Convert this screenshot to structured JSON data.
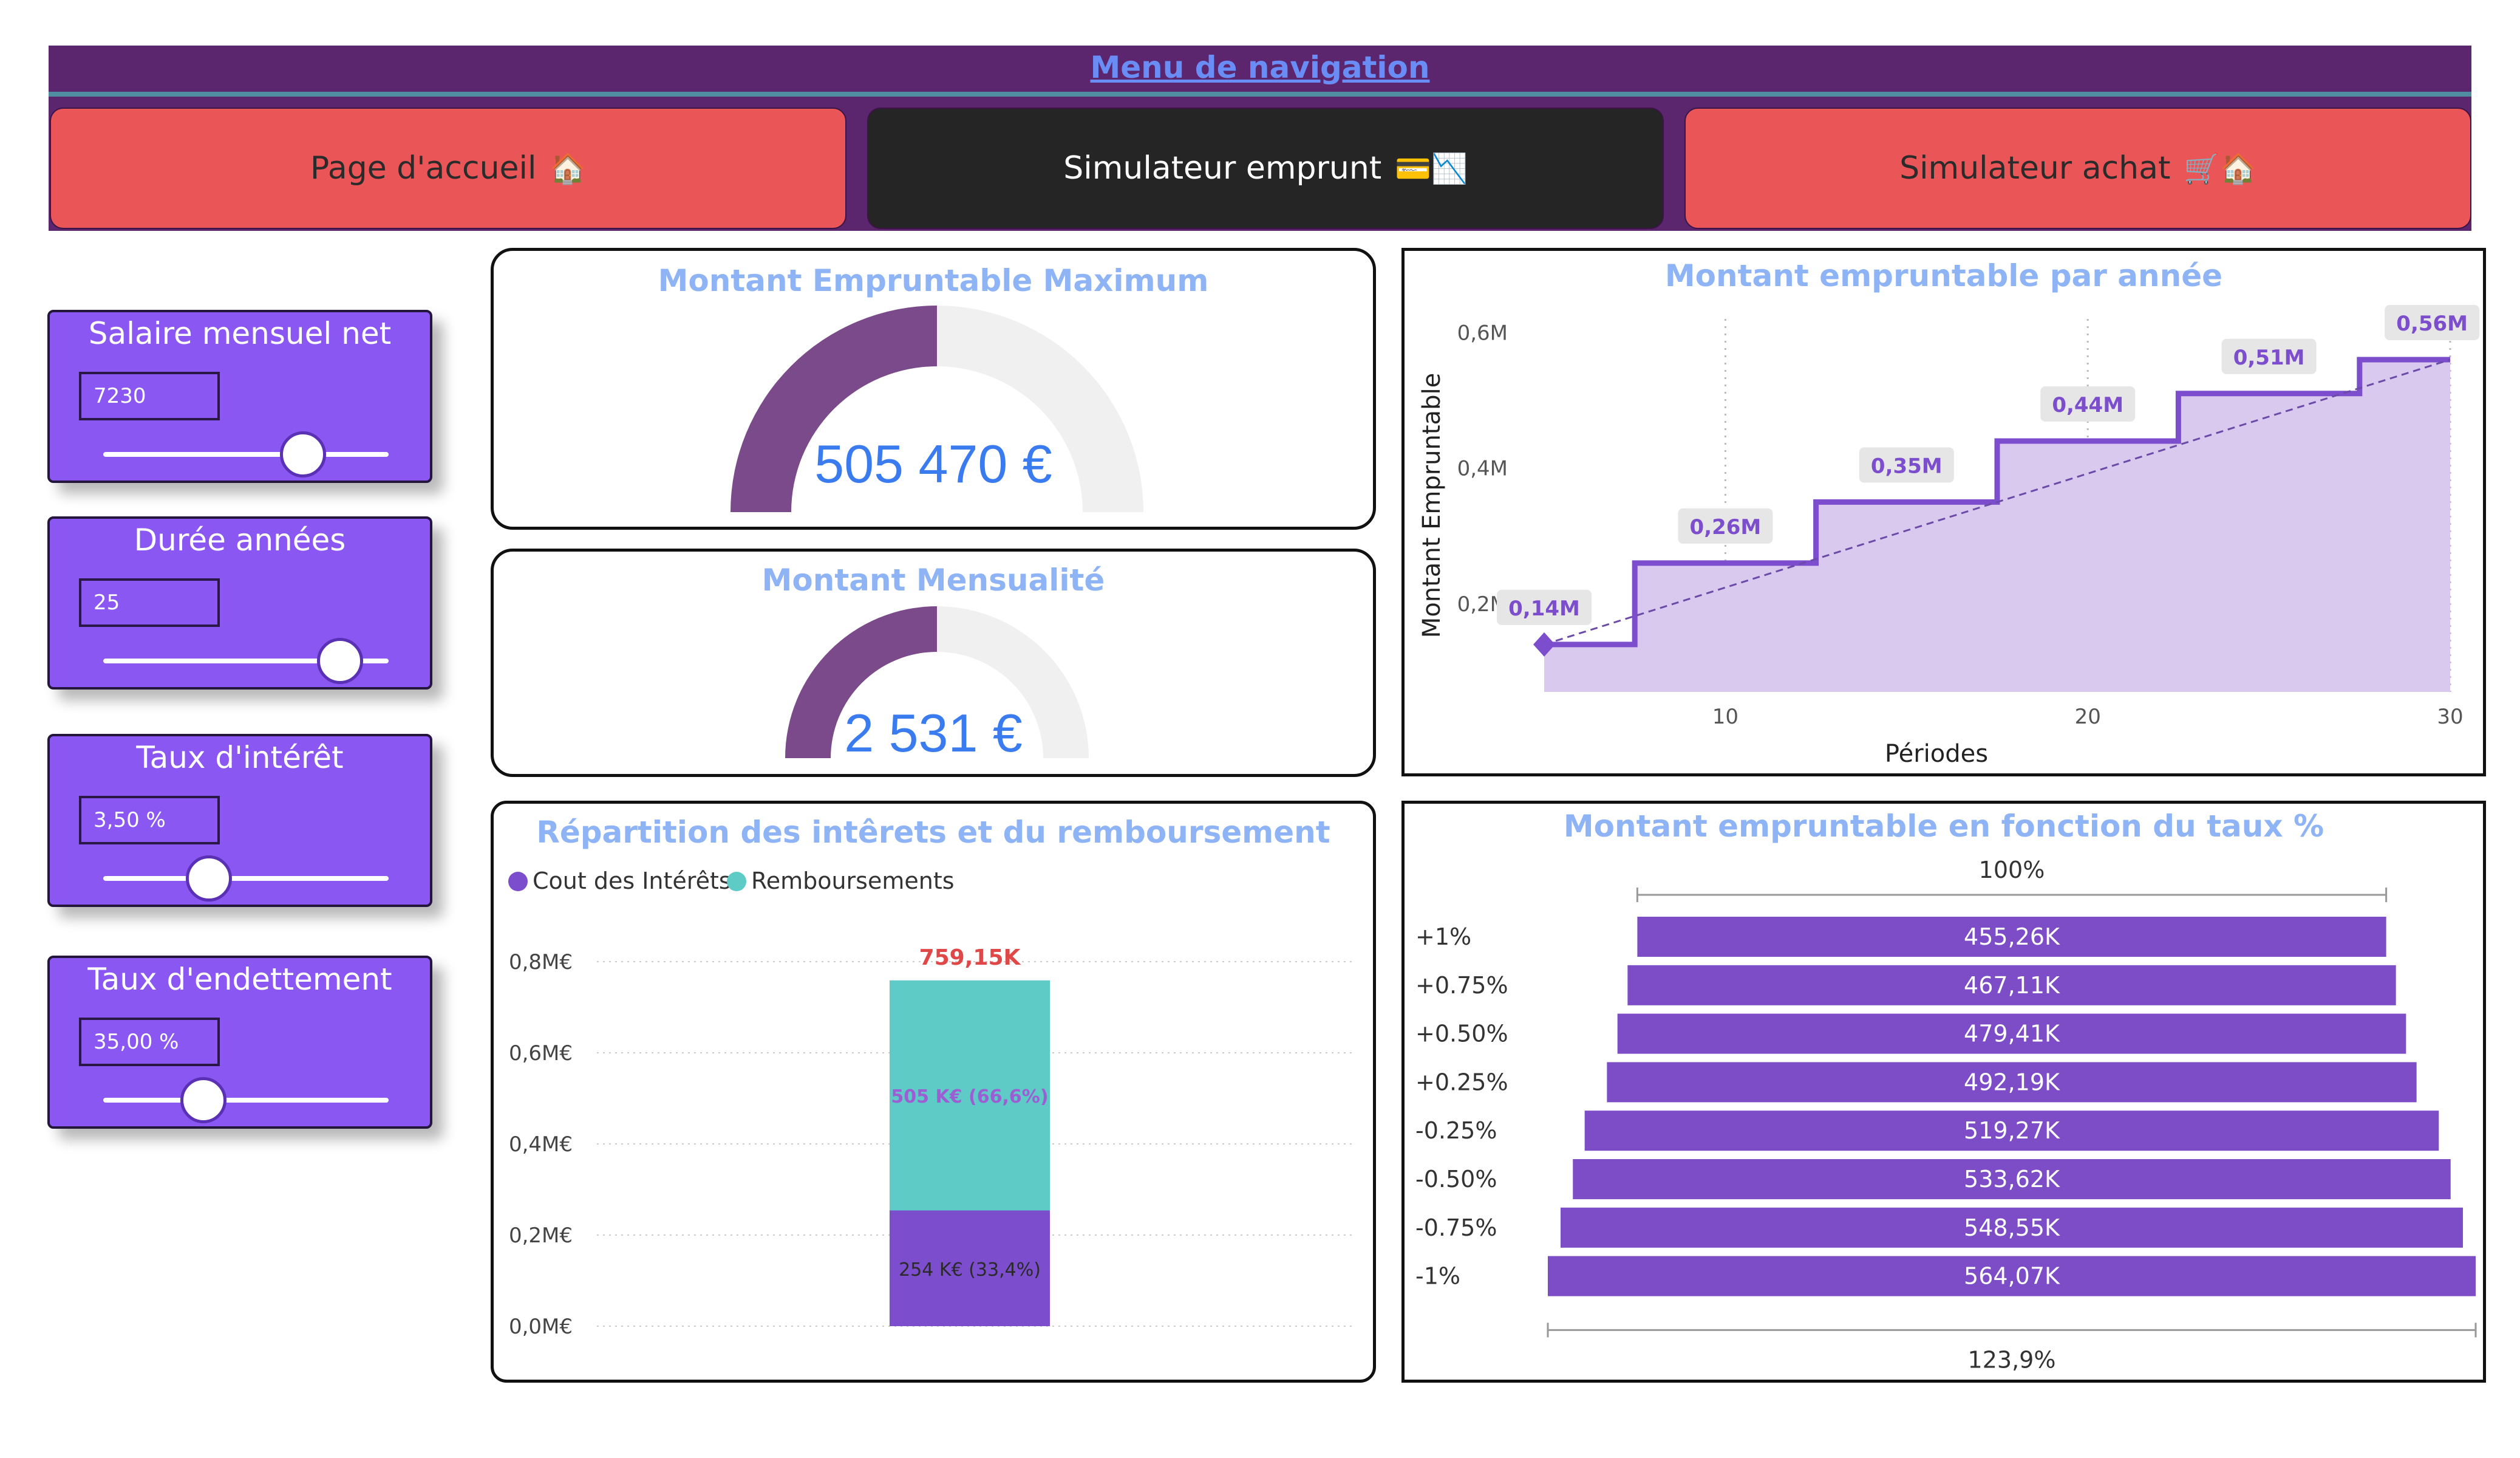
{
  "nav": {
    "title": "Menu de navigation",
    "buttons": [
      {
        "label": "Page d'accueil",
        "icons": "🏠"
      },
      {
        "label": "Simulateur emprunt",
        "icons": "💳📉"
      },
      {
        "label": "Simulateur achat",
        "icons": "🛒🏠"
      }
    ]
  },
  "slicers": [
    {
      "title": "Salaire mensuel net",
      "value": "7230",
      "level": 0.7
    },
    {
      "title": "Durée années",
      "value": "25",
      "level": 0.83
    },
    {
      "title": "Taux d'intérêt",
      "value": "3,50 %",
      "level": 0.37
    },
    {
      "title": "Taux d'endettement",
      "value": "35,00 %",
      "level": 0.35
    }
  ],
  "gauges": [
    {
      "title": "Montant Empruntable Maximum",
      "value_text": "505 470 €",
      "fraction": 0.5
    },
    {
      "title": "Montant Mensualité",
      "value_text": "2 531 €",
      "fraction": 0.5
    }
  ],
  "colors": {
    "accent_purple": "#7c4dcc",
    "gauge_fill": "#7b4a8a",
    "gauge_bg": "#f0f0f0",
    "teal": "#5ecbc6",
    "nav_purple": "#5b266e",
    "nav_red": "#ea5557",
    "slicer": "#8b57f3"
  },
  "chart_data": [
    {
      "type": "line",
      "title": "Montant empruntable par année",
      "xlabel": "Périodes",
      "ylabel": "Montant Empruntable",
      "x_ticks": [
        "10",
        "20",
        "30"
      ],
      "y_ticks": [
        "0,2M",
        "0,4M",
        "0,6M"
      ],
      "xlim": [
        5,
        30
      ],
      "ylim": [
        0.07,
        0.62
      ],
      "step_x": [
        5,
        7.5,
        12.5,
        17.5,
        22.5,
        27.5,
        30
      ],
      "step_y": [
        0.14,
        0.26,
        0.35,
        0.44,
        0.51,
        0.56,
        0.56
      ],
      "labels": [
        {
          "x": 5,
          "y": 0.14,
          "text": "0,14M"
        },
        {
          "x": 10,
          "y": 0.26,
          "text": "0,26M"
        },
        {
          "x": 15,
          "y": 0.35,
          "text": "0,35M"
        },
        {
          "x": 20,
          "y": 0.44,
          "text": "0,44M"
        },
        {
          "x": 25,
          "y": 0.51,
          "text": "0,51M"
        },
        {
          "x": 29.5,
          "y": 0.56,
          "text": "0,56M"
        }
      ],
      "trend": [
        [
          5,
          0.14
        ],
        [
          30,
          0.56
        ]
      ]
    },
    {
      "type": "bar",
      "title": "Répartition des intêrets et du remboursement",
      "legend": [
        "Cout des Intérêts",
        "Remboursements"
      ],
      "y_ticks": [
        "0,0M€",
        "0,2M€",
        "0,4M€",
        "0,6M€",
        "0,8M€"
      ],
      "ylim": [
        0,
        0.8
      ],
      "series": [
        {
          "name": "Cout des Intérêts",
          "values": [
            0.254
          ],
          "label": "254 K€ (33,4%)"
        },
        {
          "name": "Remboursements",
          "values": [
            0.505
          ],
          "label": "505 K€ (66,6%)"
        }
      ],
      "total_label": "759,15K"
    },
    {
      "type": "bar",
      "title": "Montant empruntable en fonction du taux %",
      "categories": [
        "+1%",
        "+0.75%",
        "+0.50%",
        "+0.25%",
        "-0.25%",
        "-0.50%",
        "-0.75%",
        "-1%"
      ],
      "values": [
        455.26,
        467.11,
        479.41,
        492.19,
        519.27,
        533.62,
        548.55,
        564.07
      ],
      "value_labels": [
        "455,26K",
        "467,11K",
        "479,41K",
        "492,19K",
        "519,27K",
        "533,62K",
        "548,55K",
        "564,07K"
      ],
      "top_label": "100%",
      "bottom_label": "123,9%"
    }
  ]
}
